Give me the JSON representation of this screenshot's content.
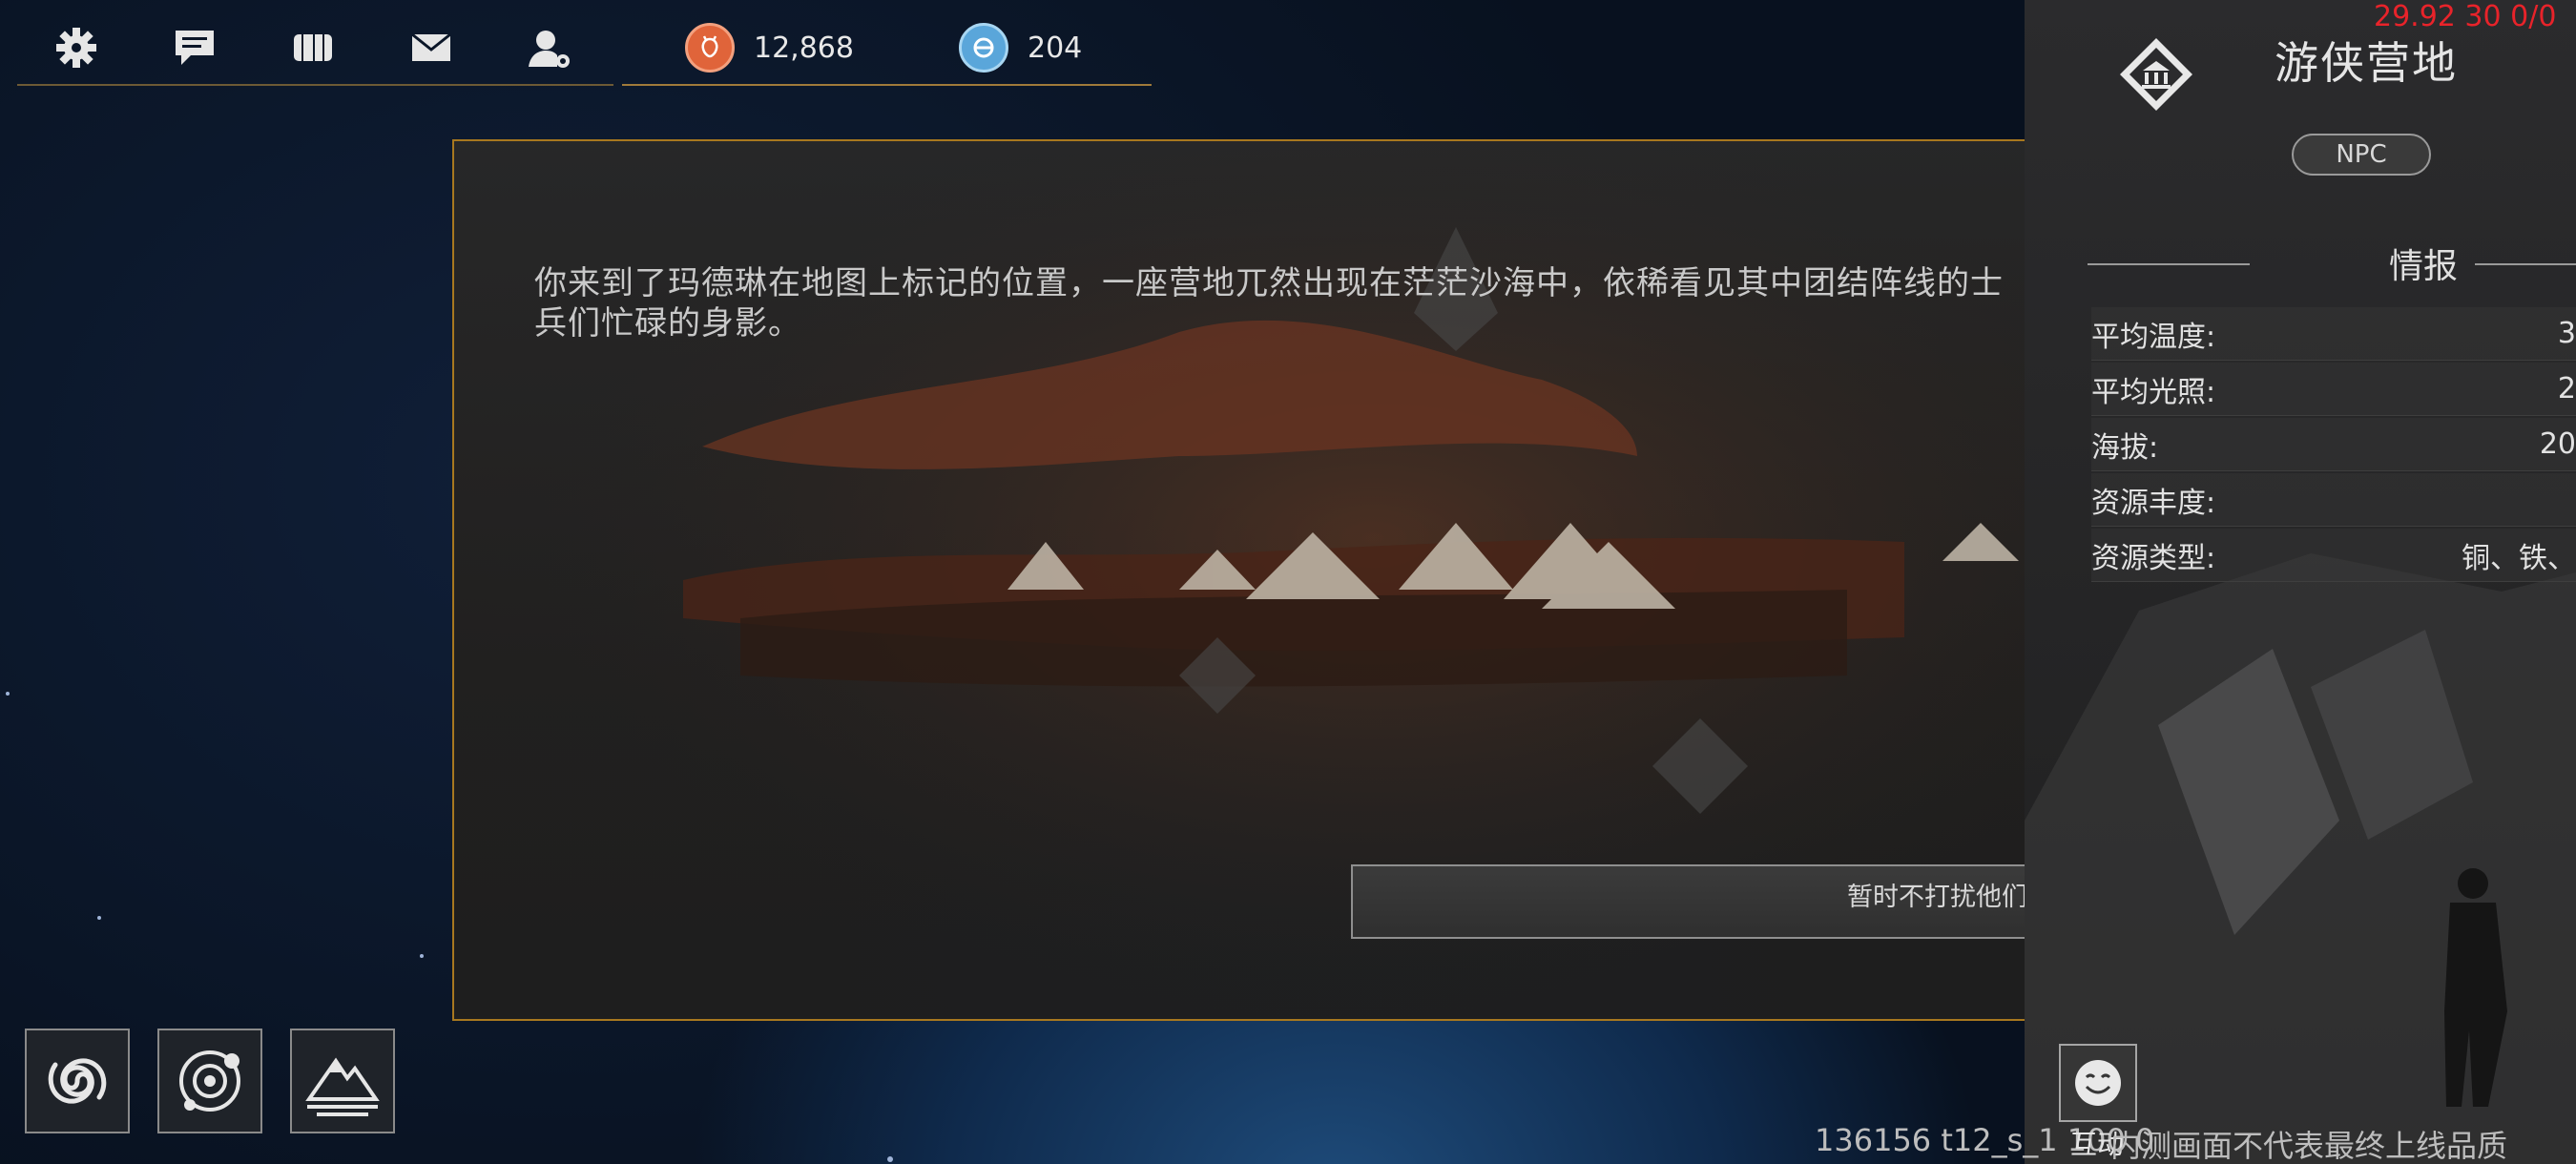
{
  "topbar": {
    "buttons": [
      {
        "icon": "gear-icon"
      },
      {
        "icon": "chat-icon"
      },
      {
        "icon": "ticket-icon"
      },
      {
        "icon": "mail-icon"
      },
      {
        "icon": "user-settings-icon"
      }
    ]
  },
  "currency": {
    "primary": {
      "icon": "orange-coin-icon",
      "value": "12,868",
      "color": "#e0643a"
    },
    "secondary": {
      "icon": "blue-coin-icon",
      "value": "204",
      "color": "#6ab6e8"
    }
  },
  "dialog": {
    "text": "你来到了玛德琳在地图上标记的位置，一座营地兀然出现在茫茫沙海中，依稀看见其中团结阵线的士兵们忙碌的身影。",
    "close_icon": "close-icon",
    "close_label": "✕",
    "choice": "暂时不打扰他们。",
    "accent": "#e08a14"
  },
  "panel": {
    "title": "游侠营地",
    "badge": "NPC",
    "section": "情报",
    "rows": [
      {
        "label": "平均温度:",
        "value": "3"
      },
      {
        "label": "平均光照:",
        "value": "2"
      },
      {
        "label": "海拔:",
        "value": "20"
      },
      {
        "label": "资源丰度:",
        "value": ""
      },
      {
        "label": "资源类型:",
        "value": "铜、铁、"
      }
    ]
  },
  "debug": "29.92 30 0/0",
  "bottom_left": [
    {
      "icon": "galaxy-icon"
    },
    {
      "icon": "planet-orbit-icon"
    },
    {
      "icon": "mountain-icon"
    }
  ],
  "interact": {
    "icon": "smile-icon",
    "label": "互动"
  },
  "version": "136156 t12_s_1 100 0",
  "disclaimer": "内测画面不代表最终上线品质"
}
